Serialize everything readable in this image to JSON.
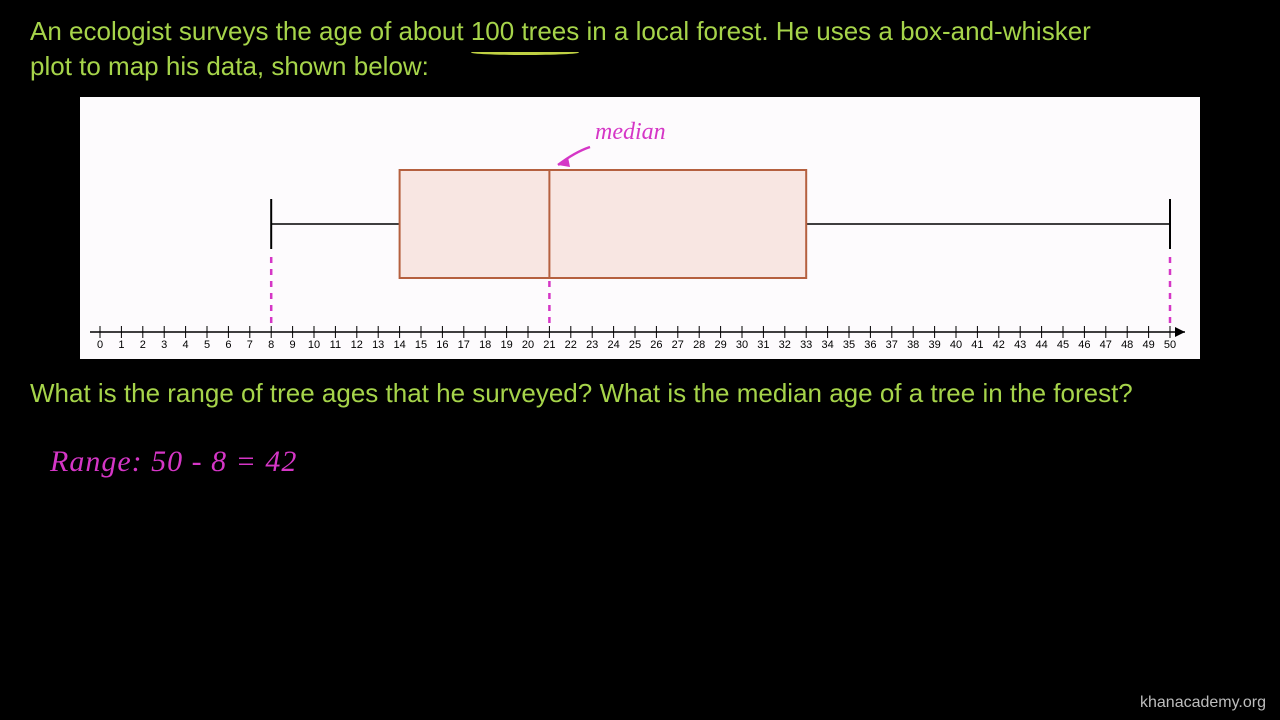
{
  "problem": {
    "line1_pre": "An ecologist surveys the age of about ",
    "highlight": "100 trees",
    "line1_post": " in a local forest. He uses a box-and-whisker",
    "line2": "plot to map his data, shown below:"
  },
  "question": "What is the range of tree ages that he surveyed? What is the median age of a tree in the forest?",
  "handwriting": {
    "range_answer": "Range:  50 - 8  =  42",
    "median_label": "median"
  },
  "watermark": "khanacademy.org",
  "chart_data": {
    "type": "boxplot",
    "title": "",
    "xlabel": "",
    "ylabel": "",
    "xlim": [
      0,
      50
    ],
    "ticks": [
      0,
      1,
      2,
      3,
      4,
      5,
      6,
      7,
      8,
      9,
      10,
      11,
      12,
      13,
      14,
      15,
      16,
      17,
      18,
      19,
      20,
      21,
      22,
      23,
      24,
      25,
      26,
      27,
      28,
      29,
      30,
      31,
      32,
      33,
      34,
      35,
      36,
      37,
      38,
      39,
      40,
      41,
      42,
      43,
      44,
      45,
      46,
      47,
      48,
      49,
      50
    ],
    "min": 8,
    "q1": 14,
    "median": 21,
    "q3": 33,
    "max": 50,
    "annotations": {
      "range": 42,
      "computation": "50 - 8 = 42"
    }
  },
  "colors": {
    "text_green": "#a6d44a",
    "hand_pink": "#d536c6",
    "box_stroke": "#b5603f",
    "box_fill": "#f8e6e2"
  }
}
